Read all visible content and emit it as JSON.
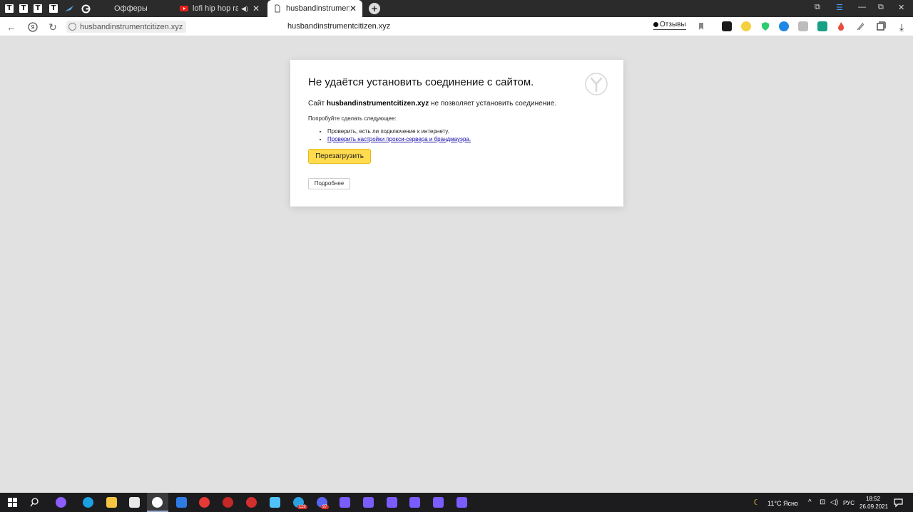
{
  "tabs": {
    "pinned": [
      "T",
      "T",
      "T",
      "T"
    ],
    "items": [
      {
        "label": "Офферы",
        "active": false
      },
      {
        "label": "lofi hip hop radio - b",
        "active": false
      },
      {
        "label": "husbandinstrumentcitiz",
        "active": true
      }
    ]
  },
  "address_bar": {
    "url": "husbandinstrumentcitizen.xyz",
    "page_title": "husbandinstrumentcitizen.xyz",
    "reviews_label": "Отзывы"
  },
  "error": {
    "title": "Не удаётся установить соединение с сайтом.",
    "message_prefix": "Сайт",
    "host": "husbandinstrumentcitizen.xyz",
    "message_suffix": "не позволяет установить соединение.",
    "try_label": "Попробуйте сделать следующее:",
    "suggestions": [
      "Проверить, есть ли подключение к интернету.",
      "Проверить настройки прокси-сервера и брандмауэра."
    ],
    "reload_label": "Перезагрузить",
    "details_label": "Подробнее"
  },
  "taskbar": {
    "weather": "11°C  Ясно",
    "lang": "РУС",
    "time": "18:52",
    "date": "26.09.2021",
    "badge_telegram": "119",
    "badge_discord": "97"
  },
  "colors": {
    "tabbar": "#2b2b2b",
    "reload_button": "#ffdb4d",
    "link": "#1a0dab",
    "page_bg": "#e1e1e1"
  }
}
